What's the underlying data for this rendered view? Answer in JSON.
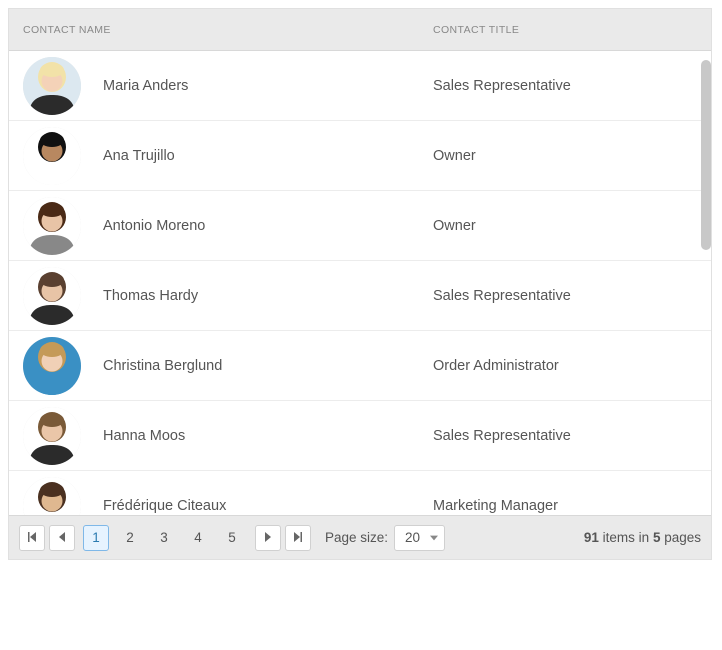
{
  "columns": {
    "name": "CONTACT NAME",
    "title": "CONTACT TITLE"
  },
  "rows": [
    {
      "name": "Maria Anders",
      "title": "Sales Representative",
      "avatar": {
        "bg": "#dce8f0",
        "hair": "#f2e2a8",
        "skin": "#f4d2b8",
        "shirt": "#2b2b2b"
      }
    },
    {
      "name": "Ana Trujillo",
      "title": "Owner",
      "avatar": {
        "bg": "#ffffff",
        "hair": "#111111",
        "skin": "#b88860",
        "shirt": "#ffffff"
      }
    },
    {
      "name": "Antonio Moreno",
      "title": "Owner",
      "avatar": {
        "bg": "#ffffff",
        "hair": "#4a2a16",
        "skin": "#e8c4a6",
        "shirt": "#888888"
      }
    },
    {
      "name": "Thomas Hardy",
      "title": "Sales Representative",
      "avatar": {
        "bg": "#ffffff",
        "hair": "#5a4030",
        "skin": "#e8c4a6",
        "shirt": "#2b2b2b"
      }
    },
    {
      "name": "Christina Berglund",
      "title": "Order Administrator",
      "avatar": {
        "bg": "#3a90c4",
        "hair": "#c49a58",
        "skin": "#f0d0b6",
        "shirt": "#3a90c4"
      }
    },
    {
      "name": "Hanna Moos",
      "title": "Sales Representative",
      "avatar": {
        "bg": "#ffffff",
        "hair": "#7a5a38",
        "skin": "#eac6a8",
        "shirt": "#2b2b2b"
      }
    },
    {
      "name": "Frédérique Citeaux",
      "title": "Marketing Manager",
      "avatar": {
        "bg": "#ffffff",
        "hair": "#4a3020",
        "skin": "#dfb890",
        "shirt": "#e8e8e8"
      }
    }
  ],
  "pager": {
    "pages": [
      "1",
      "2",
      "3",
      "4",
      "5"
    ],
    "current": 0,
    "page_size_label": "Page size:",
    "page_size_value": "20",
    "info_count": "91",
    "info_mid": " items in ",
    "info_pages": "5",
    "info_tail": " pages"
  }
}
